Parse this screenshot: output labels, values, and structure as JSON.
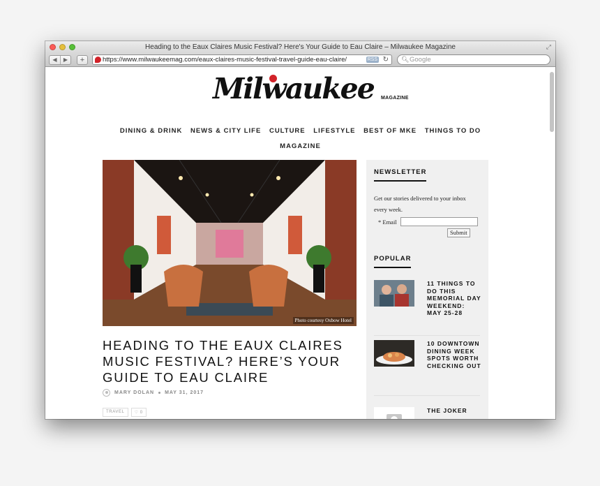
{
  "window": {
    "title": "Heading to the Eaux Claires Music Festival? Here's Your Guide to Eau Claire – Milwaukee Magazine",
    "url": "https://www.milwaukeemag.com/eaux-claires-music-festival-travel-guide-eau-claire/",
    "rss_label": "RSS",
    "search_placeholder": "Google",
    "colors": {
      "close": "#fc5b57",
      "minimize": "#e5bf3c",
      "maximize": "#57c038"
    }
  },
  "site": {
    "logo_text": "Milwaukee",
    "logo_sub": "MAGAZINE",
    "brand_color": "#d2232a",
    "nav": [
      "DINING & DRINK",
      "NEWS & CITY LIFE",
      "CULTURE",
      "LIFESTYLE",
      "BEST OF MKE",
      "THINGS TO DO",
      "MAGAZINE"
    ]
  },
  "article": {
    "photo_caption": "Photo courtesy Oxbow Hotel",
    "headline": "HEADING TO THE EAUX CLAIRES MUSIC FESTIVAL? HERE’S YOUR GUIDE TO EAU CLAIRE",
    "author": "MARY DOLAN",
    "date": "MAY 31, 2017",
    "tags": [
      "TRAVEL",
      "♡ 0"
    ]
  },
  "sidebar": {
    "newsletter_heading": "NEWSLETTER",
    "newsletter_text": "Get our stories delivered to your inbox every week.",
    "email_label": "* Email",
    "submit_label": "Submit",
    "popular_heading": "POPULAR",
    "popular": [
      {
        "title": "11 THINGS TO DO THIS MEMORIAL DAY WEEKEND: MAY 25-28",
        "thumb": "people-photo"
      },
      {
        "title": "10 DOWNTOWN DINING WEEK SPOTS WORTH CHECKING OUT",
        "thumb": "food-photo"
      },
      {
        "title": "THE JOKER",
        "thumb": "placeholder-camera"
      }
    ]
  }
}
